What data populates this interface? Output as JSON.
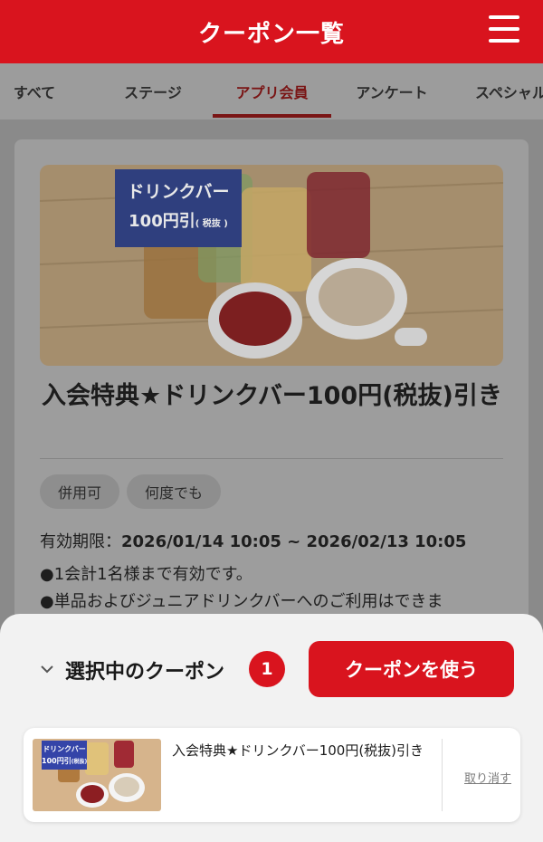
{
  "header": {
    "title": "クーポン一覧",
    "menu_icon": "hamburger-menu-icon"
  },
  "tabs": [
    {
      "label": "すべて",
      "active": false
    },
    {
      "label": "ステージ",
      "active": false
    },
    {
      "label": "アプリ会員",
      "active": true
    },
    {
      "label": "アンケート",
      "active": false
    },
    {
      "label": "スペシャル",
      "active": false
    }
  ],
  "coupon": {
    "image_banner": {
      "line1": "ドリンクバー",
      "line2": "100円引",
      "line3": "( 税抜 )"
    },
    "title": "入会特典★ドリンクバー100円(税抜)引き",
    "tags": [
      "併用可",
      "何度でも"
    ],
    "validity_label": "有効期限：",
    "validity_value": "2026/01/14 10:05 ~ 2026/02/13 10:05",
    "notes": [
      "●1会計1名様まで有効です。",
      "●単品およびジュニアドリンクバーへのご利用はできま"
    ]
  },
  "sheet": {
    "label": "選択中のクーポン",
    "count": "1",
    "use_button": "クーポンを使う",
    "item": {
      "thumb_banner": {
        "line1": "ドリンクバー",
        "line2": "100円引",
        "line3": "(税抜)"
      },
      "title": "入会特典★ドリンクバー100円(税抜)引き",
      "cancel": "取り消す"
    }
  },
  "colors": {
    "brand_red": "#d9141e",
    "active_tab": "#7a1515",
    "banner_blue": "#2f3f9e"
  }
}
